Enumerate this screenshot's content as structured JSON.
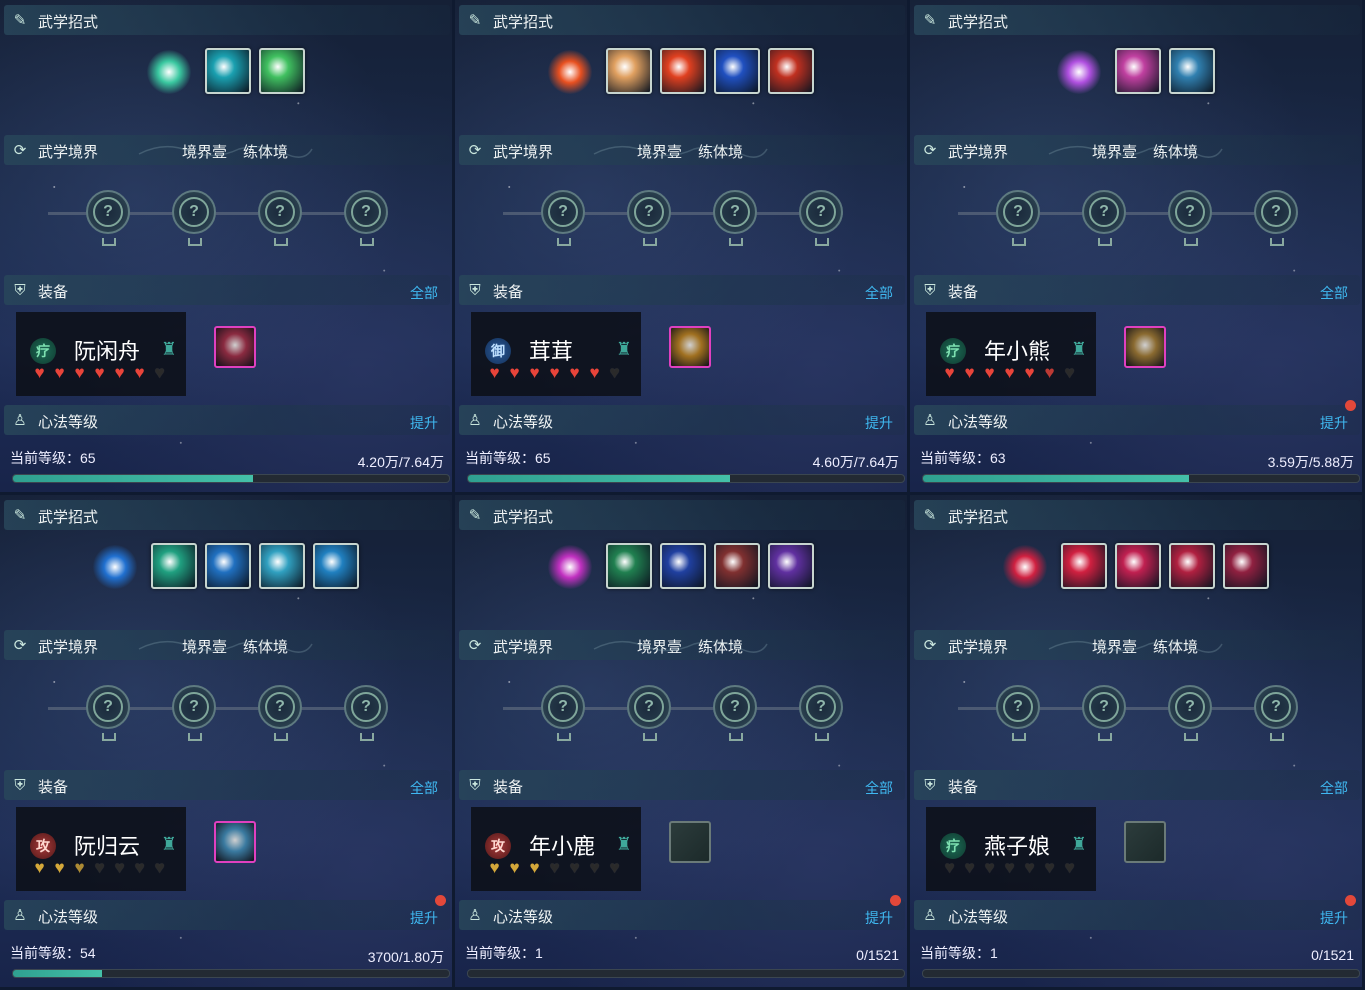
{
  "labels": {
    "skills": "武学招式",
    "realm": "武学境界",
    "realm_stage": "境界壹",
    "realm_name": "练体境",
    "equipment": "装备",
    "all": "全部",
    "heart_method": "心法等级",
    "upgrade": "提升"
  },
  "panels": [
    {
      "name": "阮闲舟",
      "role": "疗",
      "role_type": "heal",
      "main_orb_color": "#3ac8a0",
      "skill_colors": [
        "#1aa0b0",
        "#40c060"
      ],
      "hearts": [
        "red",
        "red",
        "red",
        "red",
        "red",
        "red",
        "empty"
      ],
      "equip_color": "#8a2a40",
      "equipped": true,
      "level_label": "当前等级：65",
      "exp": "4.20万/7.64万",
      "progress": 0.55,
      "notify": false
    },
    {
      "name": "茸茸",
      "role": "御",
      "role_type": "def",
      "main_orb_color": "#e85020",
      "skill_colors": [
        "#e0a060",
        "#e04020",
        "#2050c0",
        "#c03020"
      ],
      "hearts": [
        "red",
        "red",
        "red",
        "red",
        "red",
        "red",
        "empty"
      ],
      "equip_color": "#a07020",
      "equipped": true,
      "level_label": "当前等级：65",
      "exp": "4.60万/7.64万",
      "progress": 0.602,
      "notify": false
    },
    {
      "name": "年小熊",
      "role": "疗",
      "role_type": "heal",
      "main_orb_color": "#b050e0",
      "skill_colors": [
        "#c040a0",
        "#3080b0"
      ],
      "hearts": [
        "red",
        "red",
        "red",
        "red",
        "red",
        "halfred",
        "empty"
      ],
      "equip_color": "#8a6a30",
      "equipped": true,
      "level_label": "当前等级：63",
      "exp": "3.59万/5.88万",
      "progress": 0.61,
      "notify": true
    },
    {
      "name": "阮归云",
      "role": "攻",
      "role_type": "atk",
      "main_orb_color": "#2070d0",
      "skill_colors": [
        "#20a080",
        "#2070c0",
        "#30a0c0",
        "#2080c0"
      ],
      "hearts": [
        "gold",
        "gold",
        "halfgold",
        "empty",
        "empty",
        "empty",
        "empty"
      ],
      "equip_color": "#3a7aa0",
      "equipped": true,
      "level_label": "当前等级：54",
      "exp": "3700/1.80万",
      "progress": 0.205,
      "notify": true
    },
    {
      "name": "年小鹿",
      "role": "攻",
      "role_type": "atk",
      "main_orb_color": "#c030c0",
      "skill_colors": [
        "#208050",
        "#2040a0",
        "#803030",
        "#6030a0"
      ],
      "hearts": [
        "gold",
        "gold",
        "gold",
        "empty",
        "empty",
        "empty",
        "empty"
      ],
      "equip_color": "#2c3c3c",
      "equipped": false,
      "level_label": "当前等级：1",
      "exp": "0/1521",
      "progress": 0.0,
      "notify": true
    },
    {
      "name": "燕子娘",
      "role": "疗",
      "role_type": "heal",
      "main_orb_color": "#d02040",
      "skill_colors": [
        "#d02040",
        "#c02050",
        "#b02040",
        "#902040"
      ],
      "hearts": [
        "empty",
        "empty",
        "empty",
        "empty",
        "empty",
        "empty",
        "empty"
      ],
      "equip_color": "#2c3c3c",
      "equipped": false,
      "level_label": "当前等级：1",
      "exp": "0/1521",
      "progress": 0.0,
      "notify": true
    }
  ]
}
